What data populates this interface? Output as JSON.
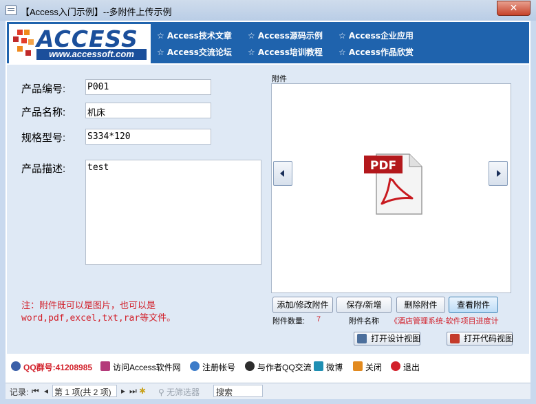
{
  "window": {
    "title": "【Access入门示例】--多附件上传示例",
    "close_label": "✕"
  },
  "banner": {
    "logo_word": "ACCESS",
    "logo_url": "www.accessoft.com",
    "links": [
      "☆ Access技术文章",
      "☆ Access源码示例",
      "☆ Access企业应用",
      "☆ Access交流论坛",
      "☆ Access培训教程",
      "☆ Access作品欣赏"
    ]
  },
  "form": {
    "code_label": "产品编号:",
    "code_value": "P001",
    "name_label": "产品名称:",
    "name_value": "机床",
    "spec_label": "规格型号:",
    "spec_value": "S334*120",
    "desc_label": "产品描述:",
    "desc_value": "test"
  },
  "attachment": {
    "label": "附件",
    "pdf_badge": "PDF",
    "buttons": [
      "添加/修改附件",
      "保存/新增",
      "删除附件",
      "查看附件"
    ],
    "count_label": "附件数量:",
    "count_value": "7",
    "name_label": "附件名称",
    "name_value": "《酒店管理系统-软件项目进度计"
  },
  "note": {
    "line1": "注：附件既可以是图片，也可以是",
    "line2": "word,pdf,excel,txt,rar等文件。"
  },
  "design_buttons": {
    "design_view": "打开设计视图",
    "code_view": "打开代码视图"
  },
  "footer_links": {
    "qq_group": "QQ群号:41208985",
    "visit": "访问Access软件网",
    "register": "注册帐号",
    "qq_author": "与作者QQ交流",
    "weibo": "微博",
    "close": "关闭",
    "exit": "退出"
  },
  "statusbar": {
    "record_label": "记录:",
    "record_text": "第 1 项(共 2 项)",
    "filter": "无筛选器",
    "search": "搜索"
  },
  "colors": {
    "banner": "#1f63ad",
    "accent_red": "#d2202a",
    "panel": "#dfe9f5"
  }
}
